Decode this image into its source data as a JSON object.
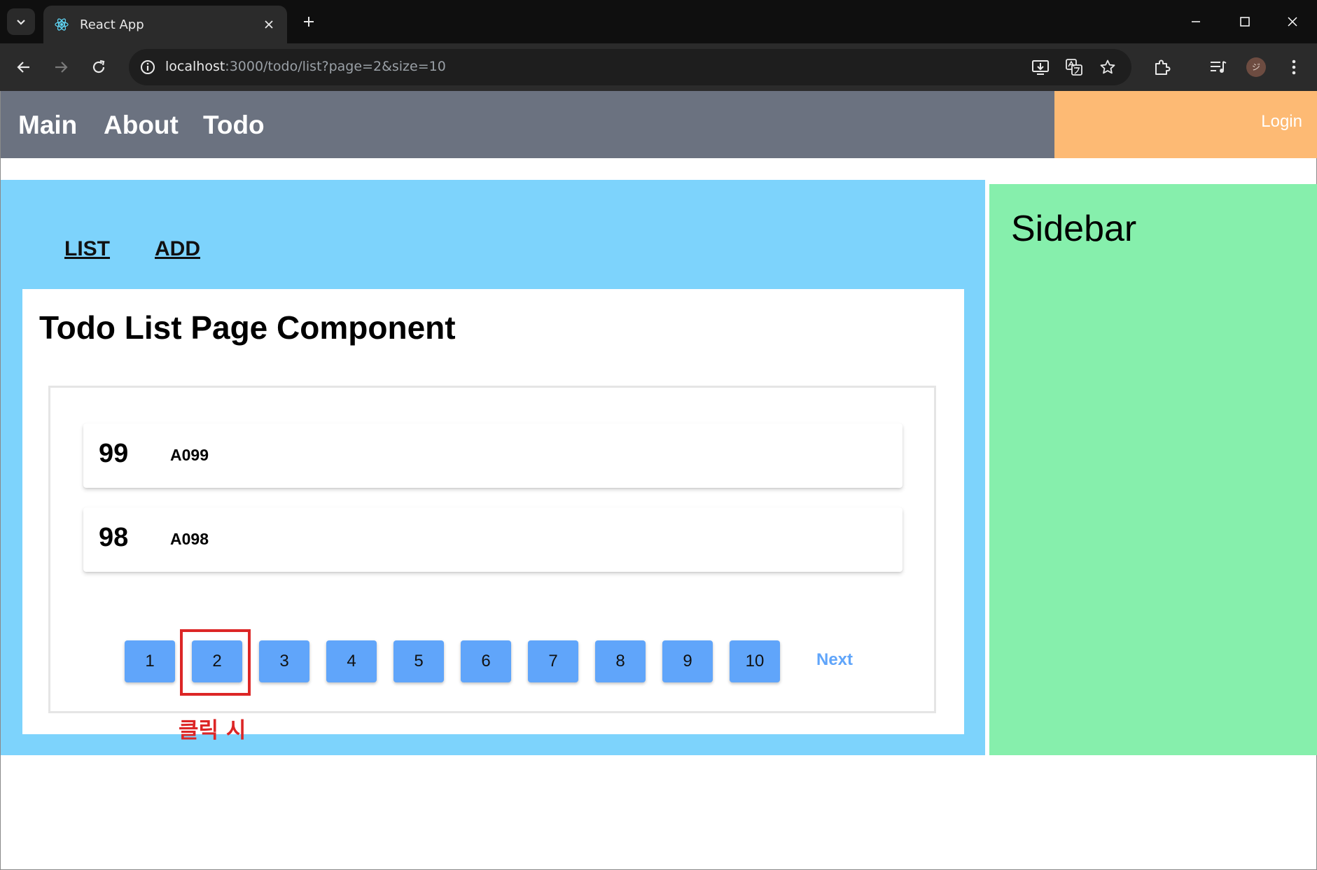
{
  "browser": {
    "tab_title": "React App",
    "url_host": "localhost",
    "url_rest": ":3000/todo/list?page=2&size=10",
    "avatar_initial": "ジ"
  },
  "nav": {
    "links": [
      "Main",
      "About",
      "Todo"
    ],
    "login_label": "Login"
  },
  "todo": {
    "sub_links": [
      "LIST",
      "ADD"
    ],
    "heading": "Todo List Page Component",
    "items": [
      {
        "tno": "99",
        "title": "A099"
      },
      {
        "tno": "98",
        "title": "A098"
      }
    ],
    "pagination": {
      "pages": [
        "1",
        "2",
        "3",
        "4",
        "5",
        "6",
        "7",
        "8",
        "9",
        "10"
      ],
      "current": "2",
      "next_label": "Next"
    }
  },
  "annotation": {
    "text": "클릭 시",
    "color": "#dc2626"
  },
  "sidebar": {
    "title": "Sidebar"
  },
  "colors": {
    "nav_bg": "#6b7280",
    "login_bg": "#fdba74",
    "main_bg": "#7dd3fc",
    "sidebar_bg": "#86efac",
    "page_button": "#60a5fa"
  }
}
